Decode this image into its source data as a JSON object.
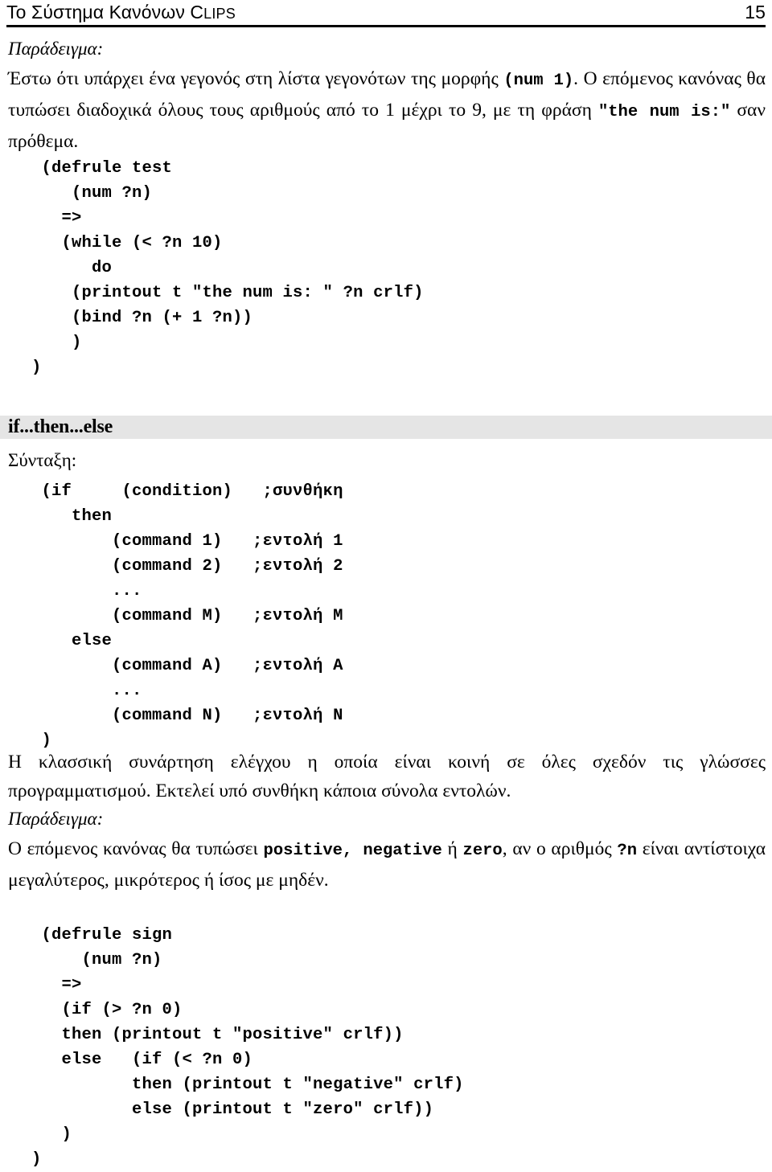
{
  "header": {
    "title_main": "Το Σύστημα Κανόνων ",
    "title_acronym_first": "C",
    "title_acronym_rest": "LIPS",
    "page_number": "15"
  },
  "section_while_example": {
    "example_label": "Παράδειγμα:",
    "paragraph_part_1": "Έστω ότι υπάρχει ένα γεγονός στη λίστα γεγονότων της μορφής ",
    "paragraph_code_1": "(num 1)",
    "paragraph_part_2": ". Ο επόμενος κανόνας θα τυπώσει διαδοχικά όλους τους αριθμούς από το 1 μέχρι το 9, με τη φράση ",
    "paragraph_code_2": "\"the num is:\"",
    "paragraph_part_3": " σαν πρόθεμα.",
    "code_block": "   (defrule test\n      (num ?n)\n     =>\n     (while (< ?n 10)\n        do\n      (printout t \"the num is: \" ?n crlf)\n      (bind ?n (+ 1 ?n))\n      )\n  )"
  },
  "section_if_then_else": {
    "heading": "if...then...else",
    "syntax_label": "Σύνταξη:",
    "syntax_code": "   (if     (condition)   ;συνθήκη\n      then\n          (command 1)   ;εντολή 1\n          (command 2)   ;εντολή 2\n          ...\n          (command M)   ;εντολή M\n      else\n          (command A)   ;εντολή A\n          ...\n          (command N)   ;εντολή N\n   )",
    "description": "Η κλασσική συνάρτηση ελέγχου η οποία είναι κοινή σε όλες σχεδόν τις γλώσσες προγραμματισμού. Εκτελεί υπό συνθήκη κάποια σύνολα εντολών.",
    "example_label": "Παράδειγμα:",
    "example_part_1": "Ο επόμενος κανόνας θα τυπώσει ",
    "example_code_1": "positive, negative",
    "example_part_2": " ή ",
    "example_code_2": "zero",
    "example_part_3": ", αν ο αριθμός ",
    "example_code_3": "?n",
    "example_part_4": " είναι αντίστοιχα μεγαλύτερος, μικρότερος ή ίσος με μηδέν.",
    "code_block": "   (defrule sign\n       (num ?n)\n     =>\n     (if (> ?n 0)\n     then (printout t \"positive\" crlf))\n     else   (if (< ?n 0)\n            then (printout t \"negative\" crlf)\n            else (printout t \"zero\" crlf))\n     )\n  )"
  },
  "colors": {
    "text": "#000000",
    "page_background": "#ffffff",
    "heading_band": "#e5e5e5",
    "rule": "#000000"
  }
}
